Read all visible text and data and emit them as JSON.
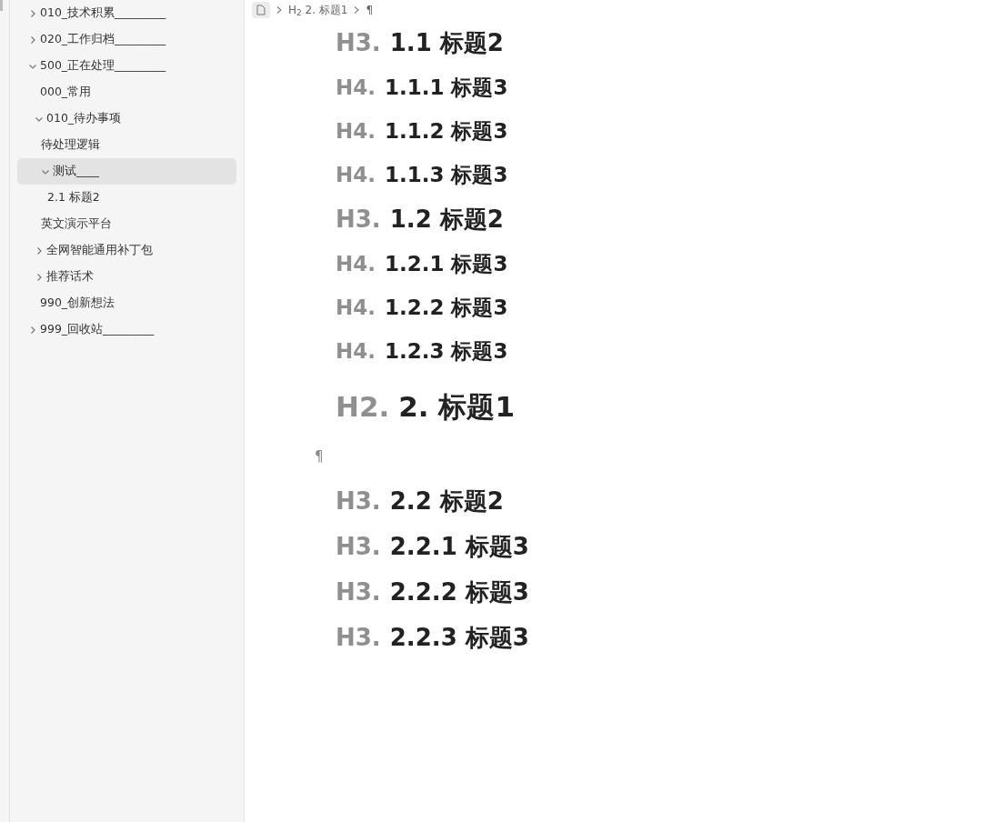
{
  "sidebar": {
    "tree": [
      {
        "label": "010_技术积累_________",
        "expanded": false,
        "selected": false
      },
      {
        "label": "020_工作归档_________",
        "expanded": false,
        "selected": false
      },
      {
        "label": "500_正在处理_________",
        "expanded": true,
        "selected": false,
        "children": [
          {
            "label": "000_常用",
            "selected": false
          },
          {
            "label": "010_待办事项",
            "expanded": true,
            "selected": false,
            "children": [
              {
                "label": "待处理逻辑",
                "selected": false
              },
              {
                "label": "测试____",
                "expanded": true,
                "selected": true,
                "children": [
                  {
                    "label": "2.1 标题2",
                    "selected": false
                  }
                ]
              },
              {
                "label": "英文演示平台",
                "selected": false
              }
            ]
          },
          {
            "label": "全网智能通用补丁包",
            "expanded": false,
            "selected": false
          },
          {
            "label": "推荐话术",
            "expanded": false,
            "selected": false
          },
          {
            "label": "990_创新想法",
            "selected": false
          }
        ]
      },
      {
        "label": "999_回收站_________",
        "expanded": false,
        "selected": false
      }
    ]
  },
  "breadcrumb": [
    {
      "kind": "file"
    },
    {
      "kind": "heading",
      "marker": "H$_{2}$",
      "text": "2. 标题1"
    },
    {
      "kind": "paragraph",
      "text": "¶"
    }
  ],
  "document": [
    {
      "kind": "h3",
      "prefix": "H3.",
      "text": "1.1 标题2"
    },
    {
      "kind": "h4",
      "prefix": "H4.",
      "text": "1.1.1 标题3"
    },
    {
      "kind": "h4",
      "prefix": "H4.",
      "text": "1.1.2 标题3"
    },
    {
      "kind": "h4",
      "prefix": "H4.",
      "text": "1.1.3 标题3"
    },
    {
      "kind": "h3",
      "prefix": "H3.",
      "text": "1.2 标题2"
    },
    {
      "kind": "h4",
      "prefix": "H4.",
      "text": "1.2.1 标题3"
    },
    {
      "kind": "h4",
      "prefix": "H4.",
      "text": "1.2.2 标题3"
    },
    {
      "kind": "h4",
      "prefix": "H4.",
      "text": "1.2.3 标题3"
    },
    {
      "kind": "h2",
      "prefix": "H2.",
      "text": "2. 标题1"
    },
    {
      "kind": "paragraph",
      "text": "¶"
    },
    {
      "kind": "h3",
      "prefix": "H3.",
      "text": "2.2 标题2"
    },
    {
      "kind": "h3",
      "prefix": "H3.",
      "text": "2.2.1 标题3"
    },
    {
      "kind": "h3",
      "prefix": "H3.",
      "text": "2.2.2 标题3"
    },
    {
      "kind": "h3",
      "prefix": "H3.",
      "text": "2.2.3 标题3"
    }
  ]
}
